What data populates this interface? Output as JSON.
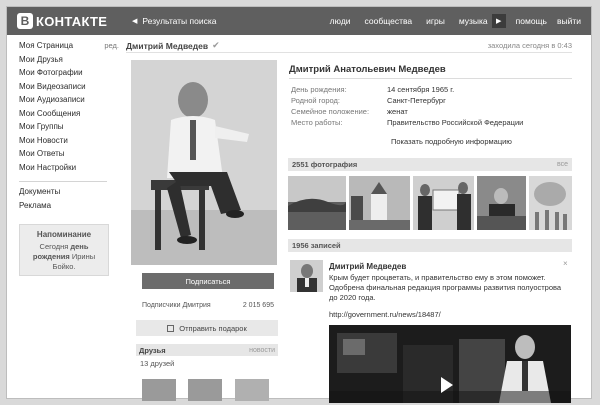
{
  "header": {
    "logo_badge": "В",
    "logo_text": "КОНТАКТЕ",
    "back_label": "Результаты поиска",
    "nav": [
      "люди",
      "сообщества",
      "игры",
      "музыка"
    ],
    "nav_after": [
      "помощь",
      "выйти"
    ]
  },
  "sidebar": {
    "items": [
      {
        "label": "Моя Страница",
        "extra": "ред."
      },
      {
        "label": "Мои Друзья"
      },
      {
        "label": "Мои Фотографии"
      },
      {
        "label": "Мои Видеозаписи"
      },
      {
        "label": "Мои Аудиозаписи"
      },
      {
        "label": "Мои Сообщения"
      },
      {
        "label": "Мои Группы"
      },
      {
        "label": "Мои Новости"
      },
      {
        "label": "Мои Ответы"
      },
      {
        "label": "Мои Настройки"
      }
    ],
    "secondary": [
      "Документы",
      "Реклама"
    ],
    "reminder": {
      "title": "Напоминание",
      "line1_pre": "Сегодня ",
      "line1_bold": "день",
      "line2_bold": "рождения",
      "line2_post": " Ирины",
      "line3": "Бойко."
    }
  },
  "profile": {
    "short_name": "Дмитрий Медведев",
    "verified_mark": "✔",
    "online": "заходила сегодня в 0:43",
    "full_name": "Дмитрий Анатольевич Медведев",
    "info": [
      {
        "key": "День рождения:",
        "value": "14 сентября 1965 г."
      },
      {
        "key": "Родной город:",
        "value": "Санкт-Петербург"
      },
      {
        "key": "Семейное положение:",
        "value": "женат"
      },
      {
        "key": "Место работы:",
        "value": "Правительство Российской Федерации"
      }
    ],
    "show_more": "Показать подробную информацию"
  },
  "actions": {
    "subscribe": "Подписаться",
    "followers_label": "Подписчики Дмитрия",
    "followers_count": "2 015 695",
    "gift": "Отправить подарок"
  },
  "friends": {
    "title": "Друзья",
    "news_link": "новости",
    "count": "13 друзей"
  },
  "photos": {
    "title": "2551 фотография",
    "all_link": "все"
  },
  "wall": {
    "title": "1956 записей",
    "post": {
      "author": "Дмитрий Медведев",
      "close": "×",
      "text": "Крым будет процветать, и правительство ему в этом поможет. Одобрена финальная редакция программы развития полуострова до 2020 года.",
      "link": "http://government.ru/news/18487/"
    }
  },
  "colors": {
    "header_bg": "#5f5f5f",
    "button_bg": "#6c6c6c",
    "bar_bg": "#e6e6e6"
  }
}
